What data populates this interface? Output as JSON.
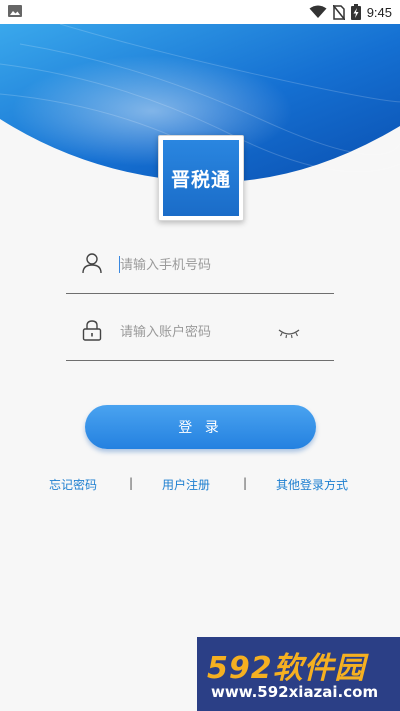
{
  "status_bar": {
    "time": "9:45"
  },
  "app": {
    "logo_text": "晋税通"
  },
  "phone_field": {
    "placeholder": "请输入手机号码",
    "value": ""
  },
  "password_field": {
    "placeholder": "请输入账户密码",
    "value": ""
  },
  "login_button": {
    "label": "登 录"
  },
  "links": {
    "forgot_password": "忘记密码",
    "separator": "|",
    "register": "用户注册",
    "other_login": "其他登录方式"
  },
  "watermark": {
    "brand": "592软件园",
    "url": "www.592xiazai.com"
  },
  "colors": {
    "primary": "#2481e0",
    "link": "#1e7fd0",
    "watermark_bg": "#2b3f86",
    "watermark_accent": "#f5b021"
  }
}
